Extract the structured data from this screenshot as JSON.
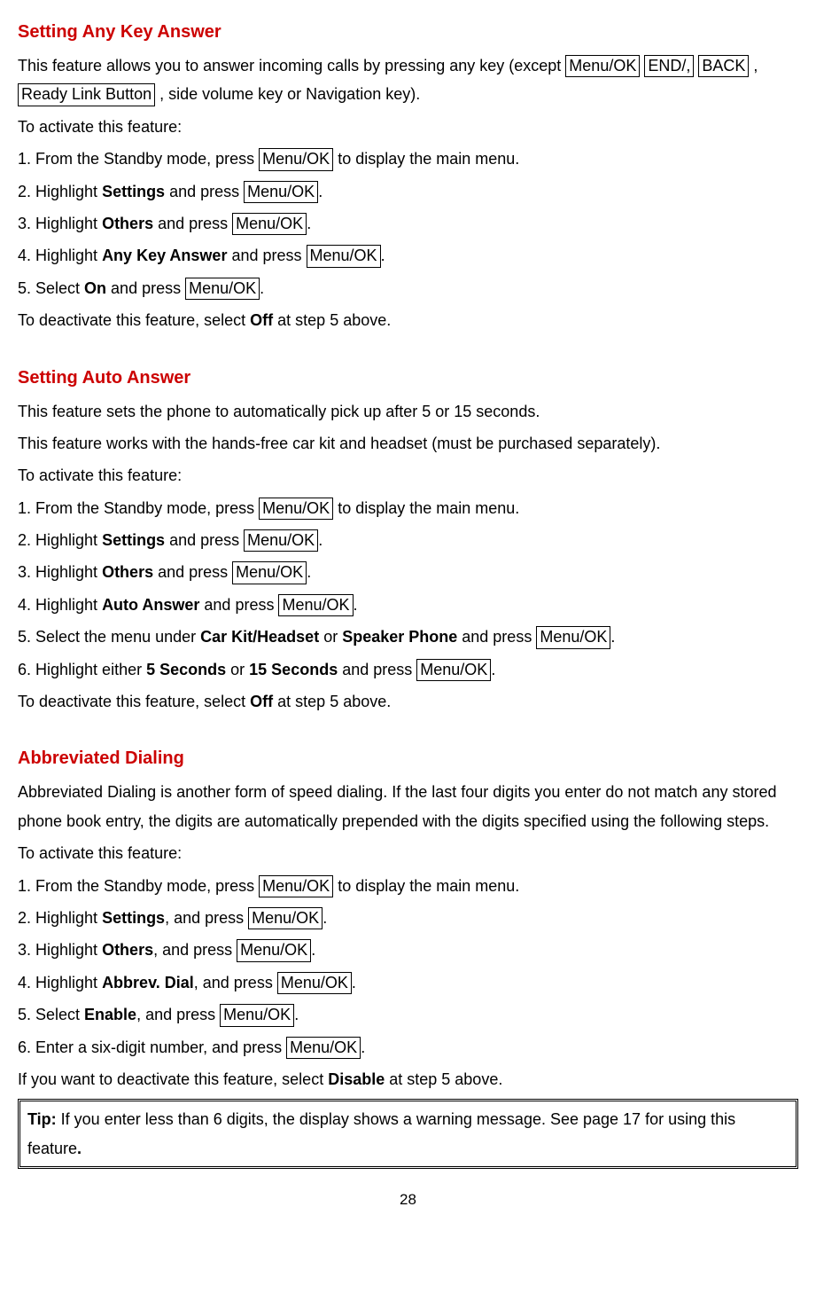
{
  "sections": {
    "anyKey": {
      "heading": "Setting Any Key Answer",
      "intro_1a": "This feature allows you to answer incoming calls by pressing any key (except ",
      "intro_key1": "Menu/OK",
      "intro_key2": "END/,",
      "intro_key3": "BACK",
      "intro_sep": " ,",
      "intro_key4": "Ready Link Button",
      "intro_1b": " , side volume key or Navigation key).",
      "activate": "To activate this feature:",
      "step1a": "1. From the Standby mode, press ",
      "step1key": "Menu/OK",
      "step1b": " to display the main menu.",
      "step2a": "2. Highlight ",
      "step2bold": "Settings",
      "step2b": " and press ",
      "step2key": "Menu/OK",
      "step2c": ".",
      "step3a": "3. Highlight ",
      "step3bold": "Others",
      "step3b": " and press ",
      "step3key": "Menu/OK",
      "step3c": ".",
      "step4a": "4. Highlight ",
      "step4bold": "Any Key Answer",
      "step4b": " and press ",
      "step4key": "Menu/OK",
      "step4c": ".",
      "step5a": "5. Select ",
      "step5bold": "On",
      "step5b": " and press ",
      "step5key": "Menu/OK",
      "step5c": ".",
      "deact_a": "To deactivate this feature, select ",
      "deact_bold": "Off",
      "deact_b": " at step 5 above."
    },
    "autoAnswer": {
      "heading": "Setting Auto Answer",
      "intro1": "This feature sets the phone to automatically pick up after 5 or 15 seconds.",
      "intro2": "This feature works with the hands-free car kit and headset (must be purchased separately).",
      "activate": "To activate this feature:",
      "step1a": "1. From the Standby mode, press ",
      "step1key": "Menu/OK",
      "step1b": " to display the main menu.",
      "step2a": "2. Highlight ",
      "step2bold": "Settings",
      "step2b": " and press ",
      "step2key": "Menu/OK",
      "step2c": ".",
      "step3a": "3. Highlight ",
      "step3bold": "Others",
      "step3b": " and press ",
      "step3key": "Menu/OK",
      "step3c": ".",
      "step4a": "4. Highlight ",
      "step4bold": "Auto Answer",
      "step4b": " and press ",
      "step4key": "Menu/OK",
      "step4c": ".",
      "step5a": "5. Select the menu under ",
      "step5bold1": "Car Kit/Headset",
      "step5mid": " or ",
      "step5bold2": "Speaker Phone",
      "step5b": " and press ",
      "step5key": "Menu/OK",
      "step5c": ".",
      "step6a": "6. Highlight either ",
      "step6bold1": "5 Seconds",
      "step6mid": " or ",
      "step6bold2": "15 Seconds",
      "step6b": " and press ",
      "step6key": "Menu/OK",
      "step6c": ".",
      "deact_a": "To deactivate this feature, select ",
      "deact_bold": "Off",
      "deact_b": " at step 5 above."
    },
    "abbrev": {
      "heading": "Abbreviated Dialing",
      "intro": "Abbreviated Dialing is another form of speed dialing. If the last four digits you enter do not match any stored phone book entry, the digits are automatically prepended with the digits specified using the following steps.",
      "activate": "To activate this feature:",
      "step1a": "1. From the Standby mode, press ",
      "step1key": "Menu/OK",
      "step1b": " to display the main menu.",
      "step2a": "2. Highlight ",
      "step2bold": "Settings",
      "step2b": ", and press ",
      "step2key": "Menu/OK",
      "step2c": ".",
      "step3a": "3. Highlight ",
      "step3bold": "Others",
      "step3b": ", and press ",
      "step3key": "Menu/OK",
      "step3c": ".",
      "step4a": "4. Highlight ",
      "step4bold": "Abbrev. Dial",
      "step4b": ", and press ",
      "step4key": "Menu/OK",
      "step4c": ".",
      "step5a": "5. Select ",
      "step5bold": "Enable",
      "step5b": ", and press ",
      "step5key": "Menu/OK",
      "step5c": ".",
      "step6a": "6. Enter a six-digit number, and press ",
      "step6key": "Menu/OK",
      "step6b": ".",
      "deact_a": "If you want to deactivate this feature, select ",
      "deact_bold": "Disable",
      "deact_b": " at step 5 above.",
      "tip_label": "Tip:",
      "tip_text": " If you enter less than 6 digits, the display shows a warning message. See page 17 for using this feature",
      "tip_period": "."
    }
  },
  "pageNumber": "28"
}
